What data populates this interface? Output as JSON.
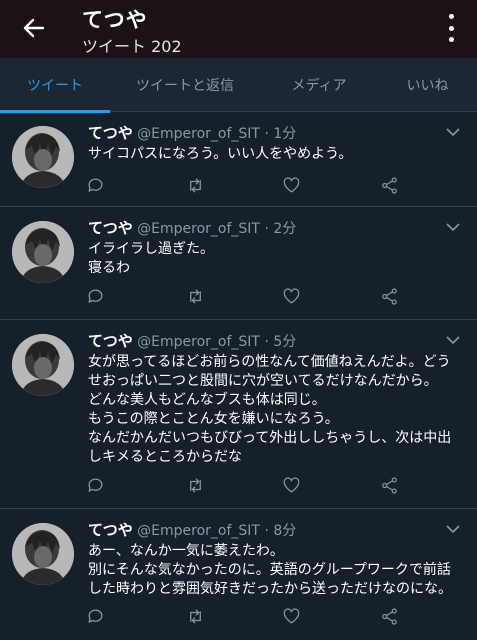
{
  "header": {
    "name": "てつや",
    "subtitle": "ツイート 202"
  },
  "tabs": [
    {
      "label": "ツイート"
    },
    {
      "label": "ツイートと返信"
    },
    {
      "label": "メディア"
    },
    {
      "label": "いいね"
    }
  ],
  "tweets": [
    {
      "name": "てつや",
      "handle": "@Emperor_of_SIT",
      "sep": "·",
      "time": "1分",
      "lines": [
        "サイコパスになろう。いい人をやめよう。"
      ]
    },
    {
      "name": "てつや",
      "handle": "@Emperor_of_SIT",
      "sep": "·",
      "time": "2分",
      "lines": [
        "イライラし過ぎた。",
        "寝るわ"
      ]
    },
    {
      "name": "てつや",
      "handle": "@Emperor_of_SIT",
      "sep": "·",
      "time": "5分",
      "lines": [
        "女が思ってるほどお前らの性なんて価値ねえんだよ。どう",
        "せおっぱい二つと股間に穴が空いてるだけなんだから。",
        "どんな美人もどんなブスも体は同じ。",
        "もうこの際とことん女を嫌いになろう。",
        "なんだかんだいつもびびって外出ししちゃうし、次は中出",
        "しキメるところからだな"
      ]
    },
    {
      "name": "てつや",
      "handle": "@Emperor_of_SIT",
      "sep": "·",
      "time": "8分",
      "lines": [
        "あー、なんか一気に萎えたわ。",
        "別にそんな気なかったのに。英語のグループワークで前話",
        "した時わりと雰囲気好きだったから送っただけなのにな。"
      ]
    }
  ],
  "colors": {
    "accent": "#1da1f2",
    "background": "#15202b",
    "header": "#1b1313",
    "muted": "#8899a6"
  },
  "icons": [
    "back-arrow-icon",
    "more-vertical-icon",
    "chevron-down-icon",
    "reply-icon",
    "retweet-icon",
    "like-icon",
    "share-icon"
  ]
}
